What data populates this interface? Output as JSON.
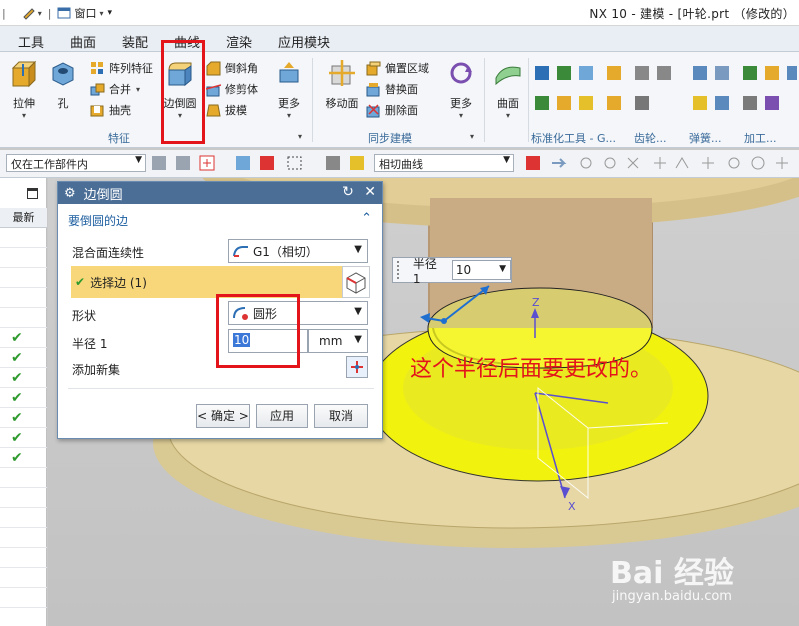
{
  "title_bar": {
    "quick_access_label": "窗口",
    "window_title": "NX 10 - 建模 - [叶轮.prt （修改的）"
  },
  "menu_tabs": [
    "工具",
    "曲面",
    "装配",
    "曲线",
    "渲染",
    "应用模块"
  ],
  "ribbon": {
    "feature": {
      "extrude": "拉伸",
      "hole": "孔",
      "pattern_feature": "阵列特征",
      "unite": "合并",
      "shell": "抽壳",
      "edge_blend": "边倒圆",
      "chamfer": "倒斜角",
      "trim_body": "修剪体",
      "draft": "拔模",
      "more": "更多",
      "group_label": "特征"
    },
    "sync": {
      "move_face": "移动面",
      "offset_region": "偏置区域",
      "replace_face": "替换面",
      "delete_face": "删除面",
      "more": "更多",
      "group_label": "同步建模"
    },
    "surface": {
      "label": "曲面"
    },
    "right_groups": {
      "standard_tools": "标准化工具 - G...",
      "gear": "齿轮...",
      "spring": "弹簧...",
      "machining": "加工..."
    }
  },
  "toolbar2": {
    "selection_filter": "仅在工作部件内",
    "curve_rule": "相切曲线"
  },
  "left_panel": {
    "header": "最新",
    "check_count": 7
  },
  "dialog": {
    "title": "边倒圆",
    "section_edges": "要倒圆的边",
    "continuity_label": "混合面连续性",
    "continuity_value": "G1（相切）",
    "select_edge": "选择边 (1)",
    "shape_label": "形状",
    "shape_value": "圆形",
    "radius_label": "半径 1",
    "radius_value": "10",
    "radius_unit": "mm",
    "add_new_set": "添加新集",
    "ok": "< 确定 >",
    "apply": "应用",
    "cancel": "取消"
  },
  "float_box": {
    "label": "半径 1",
    "value": "10"
  },
  "annotation": "这个半径后面要更改的。",
  "axis_labels": {
    "z": "Z",
    "x": "X"
  },
  "watermark": {
    "main": "Bai 经验",
    "sub": "jingyan.baidu.com"
  },
  "colors": {
    "highlight_red": "#e3151b",
    "yellow_face": "#f2f20f",
    "body_tan": "#e6d7a4",
    "dialog_title": "#4a6e96",
    "select_row": "#f8d77a"
  }
}
